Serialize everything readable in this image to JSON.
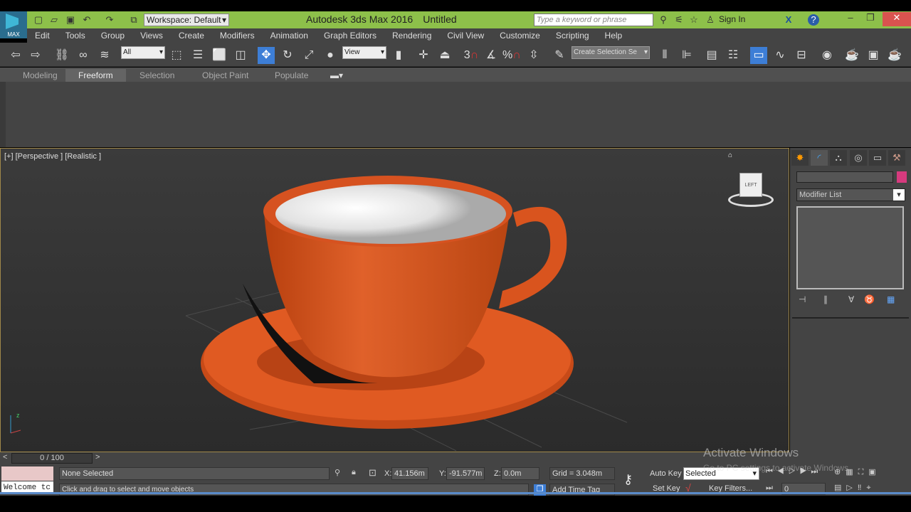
{
  "title_bar": {
    "workspace": "Workspace: Default",
    "app_name": "Autodesk 3ds Max 2016",
    "document": "Untitled",
    "search_placeholder": "Type a keyword or phrase",
    "sign_in": "Sign In",
    "logo_text": "MAX"
  },
  "menu": [
    "Edit",
    "Tools",
    "Group",
    "Views",
    "Create",
    "Modifiers",
    "Animation",
    "Graph Editors",
    "Rendering",
    "Civil View",
    "Customize",
    "Scripting",
    "Help"
  ],
  "toolbar": {
    "selection_filter": "All",
    "ref_coord": "View",
    "named_selection": "Create Selection Se",
    "snap_3": "3",
    "snap_pct": "%"
  },
  "ribbon_tabs": [
    "Modeling",
    "Freeform",
    "Selection",
    "Object Paint",
    "Populate"
  ],
  "viewport": {
    "label": "[+] [Perspective ] [Realistic ]",
    "viewcube_face": "LEFT",
    "axis_z": "z"
  },
  "command_panel": {
    "modifier_list": "Modifier List",
    "color_swatch": "#d63a7e"
  },
  "timeline": {
    "frame": "0 / 100",
    "prev": "<",
    "next": ">"
  },
  "status": {
    "selection": "None Selected",
    "prompt": "Click and drag to select and move objects",
    "listener": "Welcome tc",
    "x_label": "X:",
    "x": "41.156m",
    "y_label": "Y:",
    "y": "-91.577m",
    "z_label": "Z:",
    "z": "0.0m",
    "grid": "Grid = 3.048m",
    "add_time_tag": "Add Time Tag",
    "auto_key": "Auto Key",
    "set_key": "Set Key",
    "key_mode": "Selected",
    "key_filters": "Key Filters...",
    "current_frame": "0"
  },
  "watermark": {
    "title": "Activate Windows",
    "subtitle": "Go to PC settings to activate Windows."
  },
  "colors": {
    "title_bar": "#8dc04a",
    "accent": "#3d7ed6",
    "cup": "#d9541e"
  }
}
